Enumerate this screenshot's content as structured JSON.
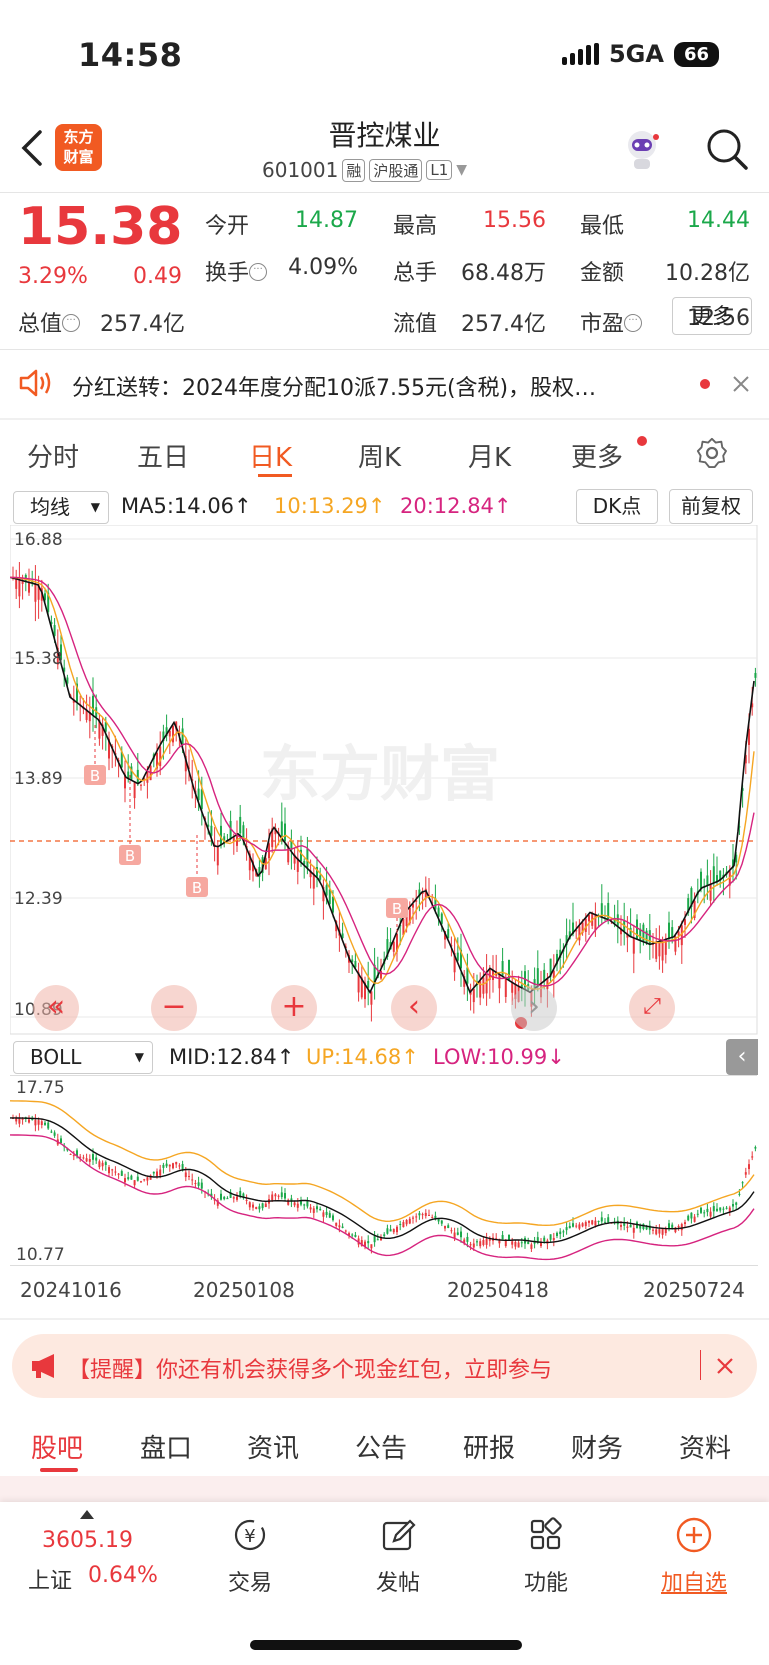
{
  "status": {
    "time": "14:58",
    "network": "5GA",
    "battery": "66"
  },
  "header": {
    "logo": "东方\n财富",
    "name": "晋控煤业",
    "code": "601001",
    "tags": [
      "融",
      "沪股通",
      "L1"
    ]
  },
  "quote": {
    "price": "15.38",
    "pct": "3.29%",
    "change": "0.49",
    "rows": [
      [
        {
          "l": "今开",
          "v": "14.87",
          "c": "green"
        },
        {
          "l": "最高",
          "v": "15.56",
          "c": "red"
        },
        {
          "l": "最低",
          "v": "14.44",
          "c": "green"
        }
      ],
      [
        {
          "l": "换手",
          "v": "4.09%",
          "c": "gray"
        },
        {
          "l": "总手",
          "v": "68.48万",
          "c": "gray"
        },
        {
          "l": "金额",
          "v": "10.28亿",
          "c": "gray"
        }
      ],
      [
        {
          "l": "总值",
          "v": "257.4亿",
          "c": "gray"
        },
        {
          "l": "流值",
          "v": "257.4亿",
          "c": "gray"
        },
        {
          "l": "市盈",
          "v": "12.56",
          "c": "gray"
        }
      ]
    ],
    "more": "更多"
  },
  "notice": {
    "text": "分红送转：2024年度分配10派7.55元(含税)，股权…"
  },
  "ktabs": [
    "分时",
    "五日",
    "日K",
    "周K",
    "月K",
    "更多"
  ],
  "legend": {
    "select": "均线",
    "ma5": "MA5:14.06",
    "ma10": "10:13.29",
    "ma20": "20:12.84",
    "dk": "DK点",
    "adj": "前复权"
  },
  "kchart": {
    "y_labels": [
      "16.88",
      "15.38",
      "13.89",
      "12.39",
      "10.89"
    ],
    "watermark": "东方财富",
    "marker": "B"
  },
  "boll": {
    "select": "BOLL",
    "mid": "MID:12.84",
    "up": "UP:14.68",
    "low": "LOW:10.99",
    "y_top": "17.75",
    "y_bottom": "10.77"
  },
  "dates": [
    "20241016",
    "20250108",
    "20250418",
    "20250724"
  ],
  "reminder": {
    "text": "【提醒】你还有机会获得多个现金红包，立即参与"
  },
  "bottom_tabs": [
    "股吧",
    "盘口",
    "资讯",
    "公告",
    "研报",
    "财务",
    "资料"
  ],
  "nav": {
    "index_value": "3605.19",
    "index_name": "上证",
    "index_pct": "0.64%",
    "items": [
      "交易",
      "发帖",
      "功能",
      "加自选"
    ]
  },
  "colors": {
    "red": "#e8383d",
    "green": "#1ba84a",
    "orange": "#f15a22",
    "ma10": "#f5a623",
    "ma20": "#d6247f"
  }
}
